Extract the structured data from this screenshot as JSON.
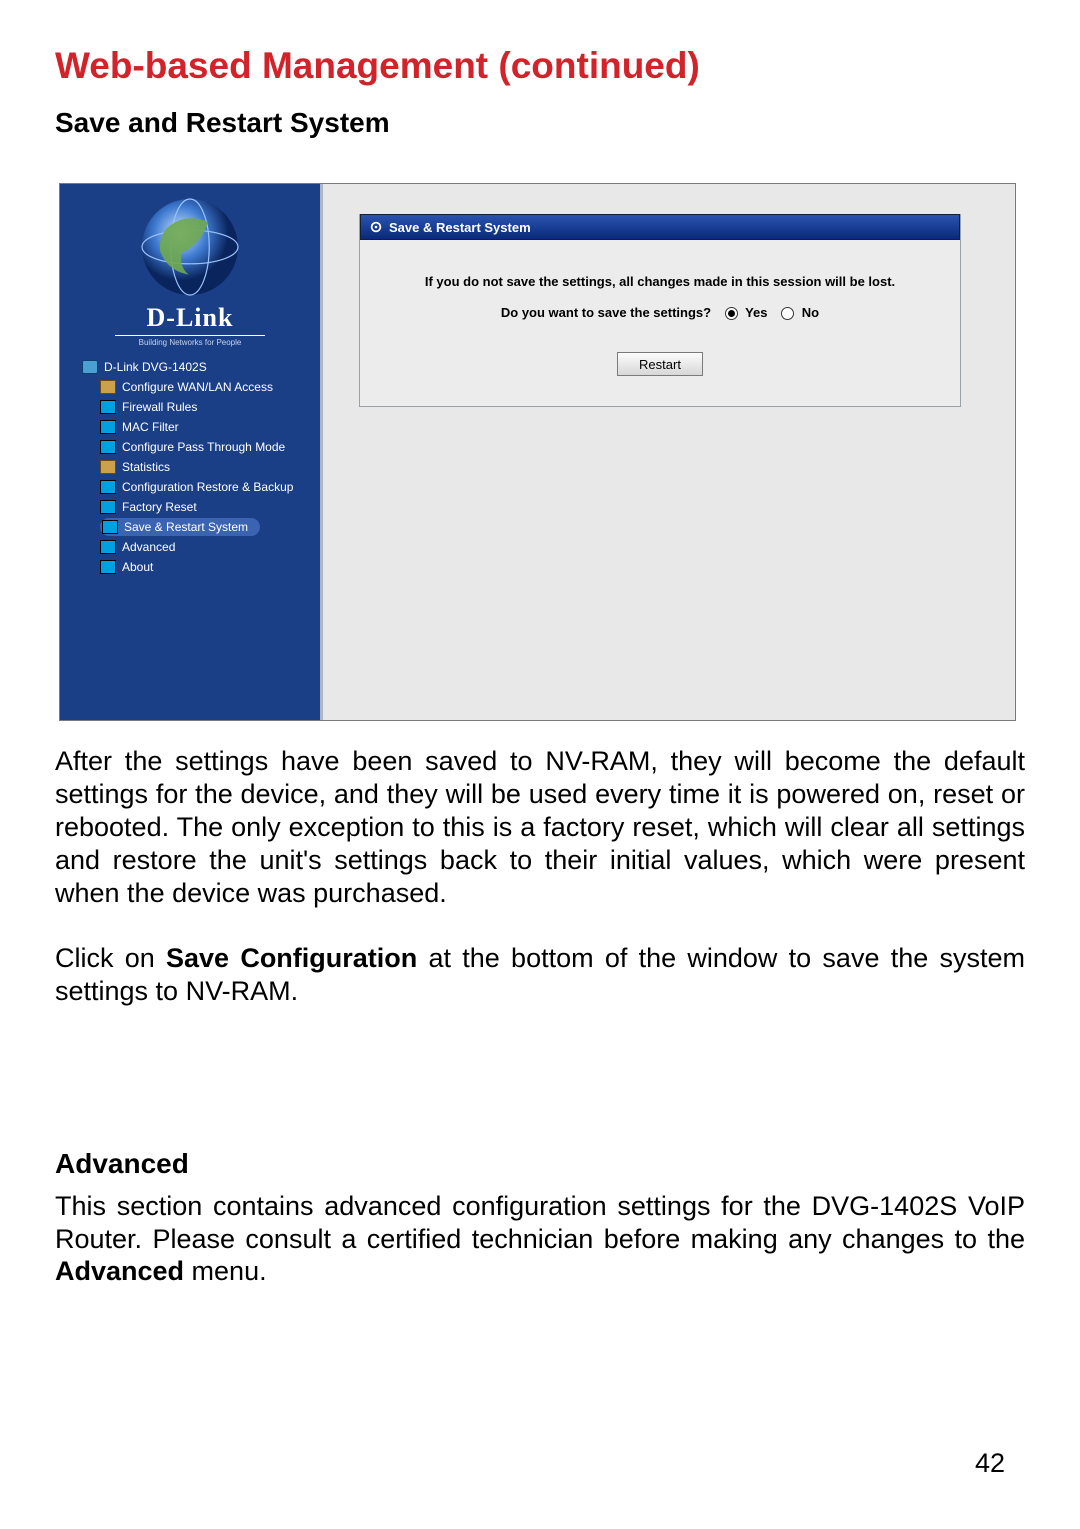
{
  "page": {
    "title": "Web-based Management (continued)",
    "section_title": "Save and Restart System",
    "para1": "After the settings have been saved to NV-RAM, they will become the default settings for the device, and they will be used every time it is powered on, reset or rebooted. The only exception to this is a factory reset, which will clear all settings and restore the unit's settings back to their initial values, which were present when the device was purchased.",
    "para2_pre": "Click on ",
    "para2_bold": "Save Configuration",
    "para2_post": " at the bottom of the window to save the system settings to NV-RAM.",
    "section2_title": "Advanced",
    "para3_pre": "This section contains advanced configuration settings for the DVG-1402S VoIP Router. Please consult a certified technician before making any changes to the ",
    "para3_bold": "Advanced",
    "para3_post": " menu.",
    "page_number": "42"
  },
  "router_ui": {
    "brand": "D-Link",
    "tagline": "Building Networks for People",
    "tree": {
      "root": "D-Link DVG-1402S",
      "items": [
        "Configure WAN/LAN Access",
        "Firewall Rules",
        "MAC Filter",
        "Configure Pass Through Mode",
        "Statistics",
        "Configuration Restore & Backup",
        "Factory Reset",
        "Save & Restart System",
        "Advanced",
        "About"
      ],
      "selected": "Save & Restart System"
    },
    "panel": {
      "title": "Save & Restart System",
      "warning": "If you do not save the settings, all changes made in this session will be lost.",
      "prompt": "Do you want to save the settings?",
      "yes": "Yes",
      "no": "No",
      "button": "Restart"
    }
  }
}
